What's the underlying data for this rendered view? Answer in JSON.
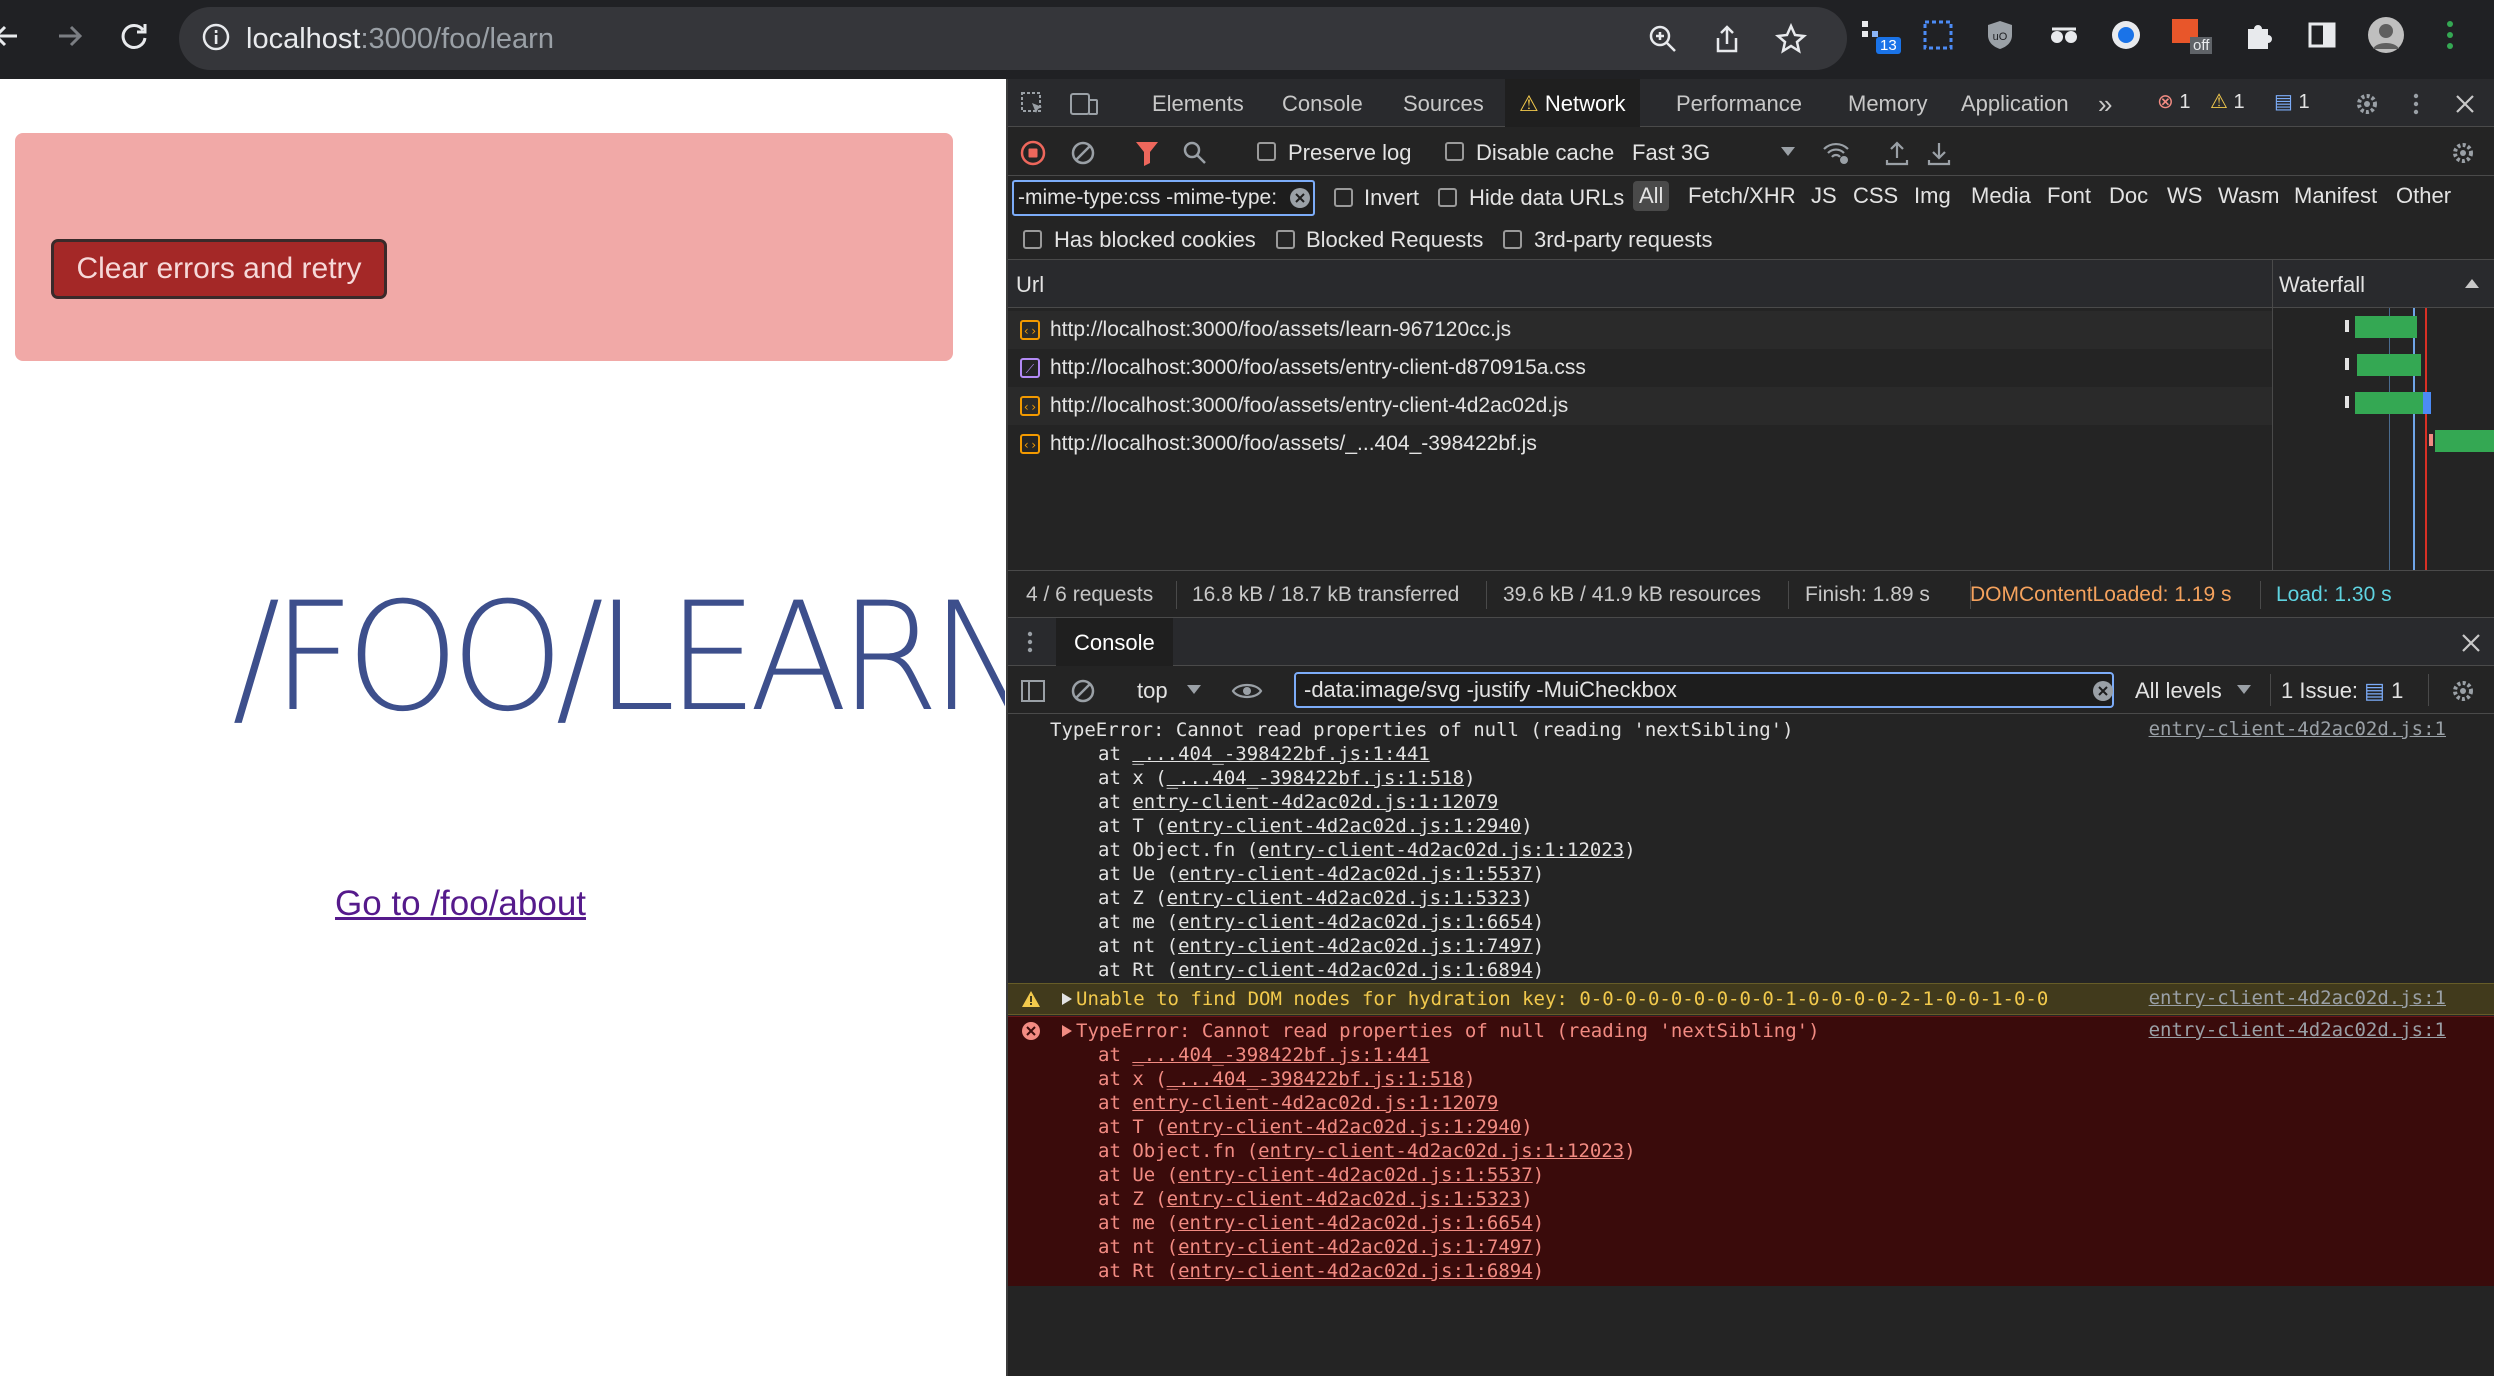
{
  "browser": {
    "url_host": "localhost",
    "url_rest": ":3000/foo/learn",
    "ext_badge_count": "13",
    "ext_off_label": "off"
  },
  "page": {
    "retry_label": "Clear errors and retry",
    "heading": "/FOO/LEARN",
    "about_link": "Go to /foo/about"
  },
  "devtools": {
    "tabs": [
      "Elements",
      "Console",
      "Sources",
      "Network",
      "Performance",
      "Memory",
      "Application"
    ],
    "error_count": "1",
    "warning_count": "1",
    "message_count": "1",
    "network": {
      "preserve_log": "Preserve log",
      "disable_cache": "Disable cache",
      "throttling": "Fast 3G",
      "filter_value": "-mime-type:css -mime-type:",
      "invert": "Invert",
      "hide_data_urls": "Hide data URLs",
      "type_filters": [
        "All",
        "Fetch/XHR",
        "JS",
        "CSS",
        "Img",
        "Media",
        "Font",
        "Doc",
        "WS",
        "Wasm",
        "Manifest",
        "Other"
      ],
      "has_blocked_cookies": "Has blocked cookies",
      "blocked_requests": "Blocked Requests",
      "third_party": "3rd-party requests",
      "col_url": "Url",
      "col_waterfall": "Waterfall",
      "requests": [
        {
          "url": "http://localhost:3000/foo/assets/learn-967120cc.js",
          "type": "js"
        },
        {
          "url": "http://localhost:3000/foo/assets/entry-client-d870915a.css",
          "type": "css"
        },
        {
          "url": "http://localhost:3000/foo/assets/entry-client-4d2ac02d.js",
          "type": "js"
        },
        {
          "url": "http://localhost:3000/foo/assets/_...404_-398422bf.js",
          "type": "js"
        }
      ],
      "summary": {
        "requests": "4 / 6 requests",
        "transferred": "16.8 kB / 18.7 kB transferred",
        "resources": "39.6 kB / 41.9 kB resources",
        "finish": "Finish: 1.89 s",
        "dcl": "DOMContentLoaded: 1.19 s",
        "load": "Load: 1.30 s"
      }
    },
    "console": {
      "tab_label": "Console",
      "context": "top",
      "filter_value": "-data:image/svg -justify -MuiCheckbox",
      "levels": "All levels",
      "issues": "1 Issue:",
      "issues_count": "1",
      "entry1": {
        "message": "TypeError: Cannot read properties of null (reading 'nextSibling')",
        "source": "entry-client-4d2ac02d.js:1"
      },
      "warning": {
        "message": "Unable to find DOM nodes for hydration key: 0-0-0-0-0-0-0-0-0-1-0-0-0-0-2-1-0-0-1-0-0",
        "source": "entry-client-4d2ac02d.js:1"
      },
      "entry2": {
        "message": "TypeError: Cannot read properties of null (reading 'nextSibling')",
        "source": "entry-client-4d2ac02d.js:1"
      },
      "stack": [
        {
          "pre": "at ",
          "link": "_...404_-398422bf.js:1:441",
          "wrap": false
        },
        {
          "pre": "at x (",
          "link": "_...404_-398422bf.js:1:518",
          "wrap": true
        },
        {
          "pre": "at ",
          "link": "entry-client-4d2ac02d.js:1:12079",
          "wrap": false
        },
        {
          "pre": "at T (",
          "link": "entry-client-4d2ac02d.js:1:2940",
          "wrap": true
        },
        {
          "pre": "at Object.fn (",
          "link": "entry-client-4d2ac02d.js:1:12023",
          "wrap": true
        },
        {
          "pre": "at Ue (",
          "link": "entry-client-4d2ac02d.js:1:5537",
          "wrap": true
        },
        {
          "pre": "at Z (",
          "link": "entry-client-4d2ac02d.js:1:5323",
          "wrap": true
        },
        {
          "pre": "at me (",
          "link": "entry-client-4d2ac02d.js:1:6654",
          "wrap": true
        },
        {
          "pre": "at nt (",
          "link": "entry-client-4d2ac02d.js:1:7497",
          "wrap": true
        },
        {
          "pre": "at Rt (",
          "link": "entry-client-4d2ac02d.js:1:6894",
          "wrap": true
        }
      ],
      "prompt": "›"
    }
  },
  "colors": {
    "error_bg": "#f1a9a7",
    "retry_bg": "#a42827",
    "heading": "#3d4f8c",
    "dcl": "#f5a25d",
    "load": "#5fd3e0",
    "waterfall_bar": "#34a853"
  }
}
